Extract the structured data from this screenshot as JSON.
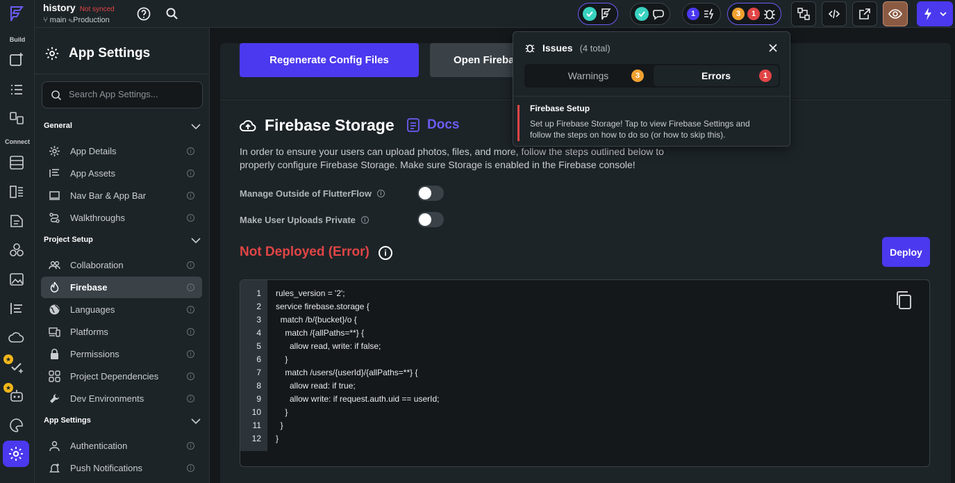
{
  "topbar": {
    "project_name": "history",
    "sync_status": "Not synced",
    "branch": "main",
    "environment": "Production",
    "warnings_count": "1",
    "issues_warnings": "3",
    "issues_errors": "1"
  },
  "rail": {
    "build_label": "Build",
    "connect_label": "Connect"
  },
  "sidebar": {
    "title": "App Settings",
    "search_placeholder": "Search App Settings...",
    "groups": [
      {
        "label": "General",
        "items": [
          {
            "label": "App Details",
            "icon": "gear-icon"
          },
          {
            "label": "App Assets",
            "icon": "assets-icon"
          },
          {
            "label": "Nav Bar & App Bar",
            "icon": "laptop-icon"
          },
          {
            "label": "Walkthroughs",
            "icon": "route-icon"
          }
        ]
      },
      {
        "label": "Project Setup",
        "items": [
          {
            "label": "Collaboration",
            "icon": "people-icon"
          },
          {
            "label": "Firebase",
            "icon": "firebase-icon",
            "selected": true
          },
          {
            "label": "Languages",
            "icon": "globe-icon"
          },
          {
            "label": "Platforms",
            "icon": "devices-icon"
          },
          {
            "label": "Permissions",
            "icon": "lock-icon"
          },
          {
            "label": "Project Dependencies",
            "icon": "grid-icon"
          },
          {
            "label": "Dev Environments",
            "icon": "wrench-icon"
          }
        ]
      },
      {
        "label": "App Settings",
        "items": [
          {
            "label": "Authentication",
            "icon": "person-icon"
          },
          {
            "label": "Push Notifications",
            "icon": "bell-icon"
          }
        ]
      }
    ]
  },
  "main": {
    "regen_button": "Regenerate Config Files",
    "open_firebase_button": "Open Firebase",
    "storage_title": "Firebase Storage",
    "docs_label": "Docs",
    "description": "In order to ensure your users can upload photos, files, and more, follow the steps outlined below to properly configure Firebase Storage. Make sure Storage is enabled in the Firebase console!",
    "manage_outside_label": "Manage Outside of FlutterFlow",
    "private_uploads_label": "Make User Uploads Private",
    "status_label": "Not Deployed (Error)",
    "deploy_button": "Deploy",
    "code_lines": [
      "rules_version = '2';",
      "service firebase.storage {",
      "  match /b/{bucket}/o {",
      "    match /{allPaths=**} {",
      "      allow read, write: if false;",
      "    }",
      "    match /users/{userId}/{allPaths=**} {",
      "      allow read: if true;",
      "      allow write: if request.auth.uid == userId;",
      "    }",
      "  }",
      "}"
    ]
  },
  "issues_popup": {
    "title": "Issues",
    "total": "(4 total)",
    "warnings_tab": "Warnings",
    "warnings_count": "3",
    "errors_tab": "Errors",
    "errors_count": "1",
    "issue_title": "Firebase Setup",
    "issue_desc": "Set up Firebase Storage! Tap to view Firebase Settings and follow the steps on how to do so (or how to skip this)."
  },
  "colors": {
    "accent": "#4b39ef",
    "error": "#e14545",
    "warning": "#f0a030",
    "success": "#39d2c0"
  }
}
